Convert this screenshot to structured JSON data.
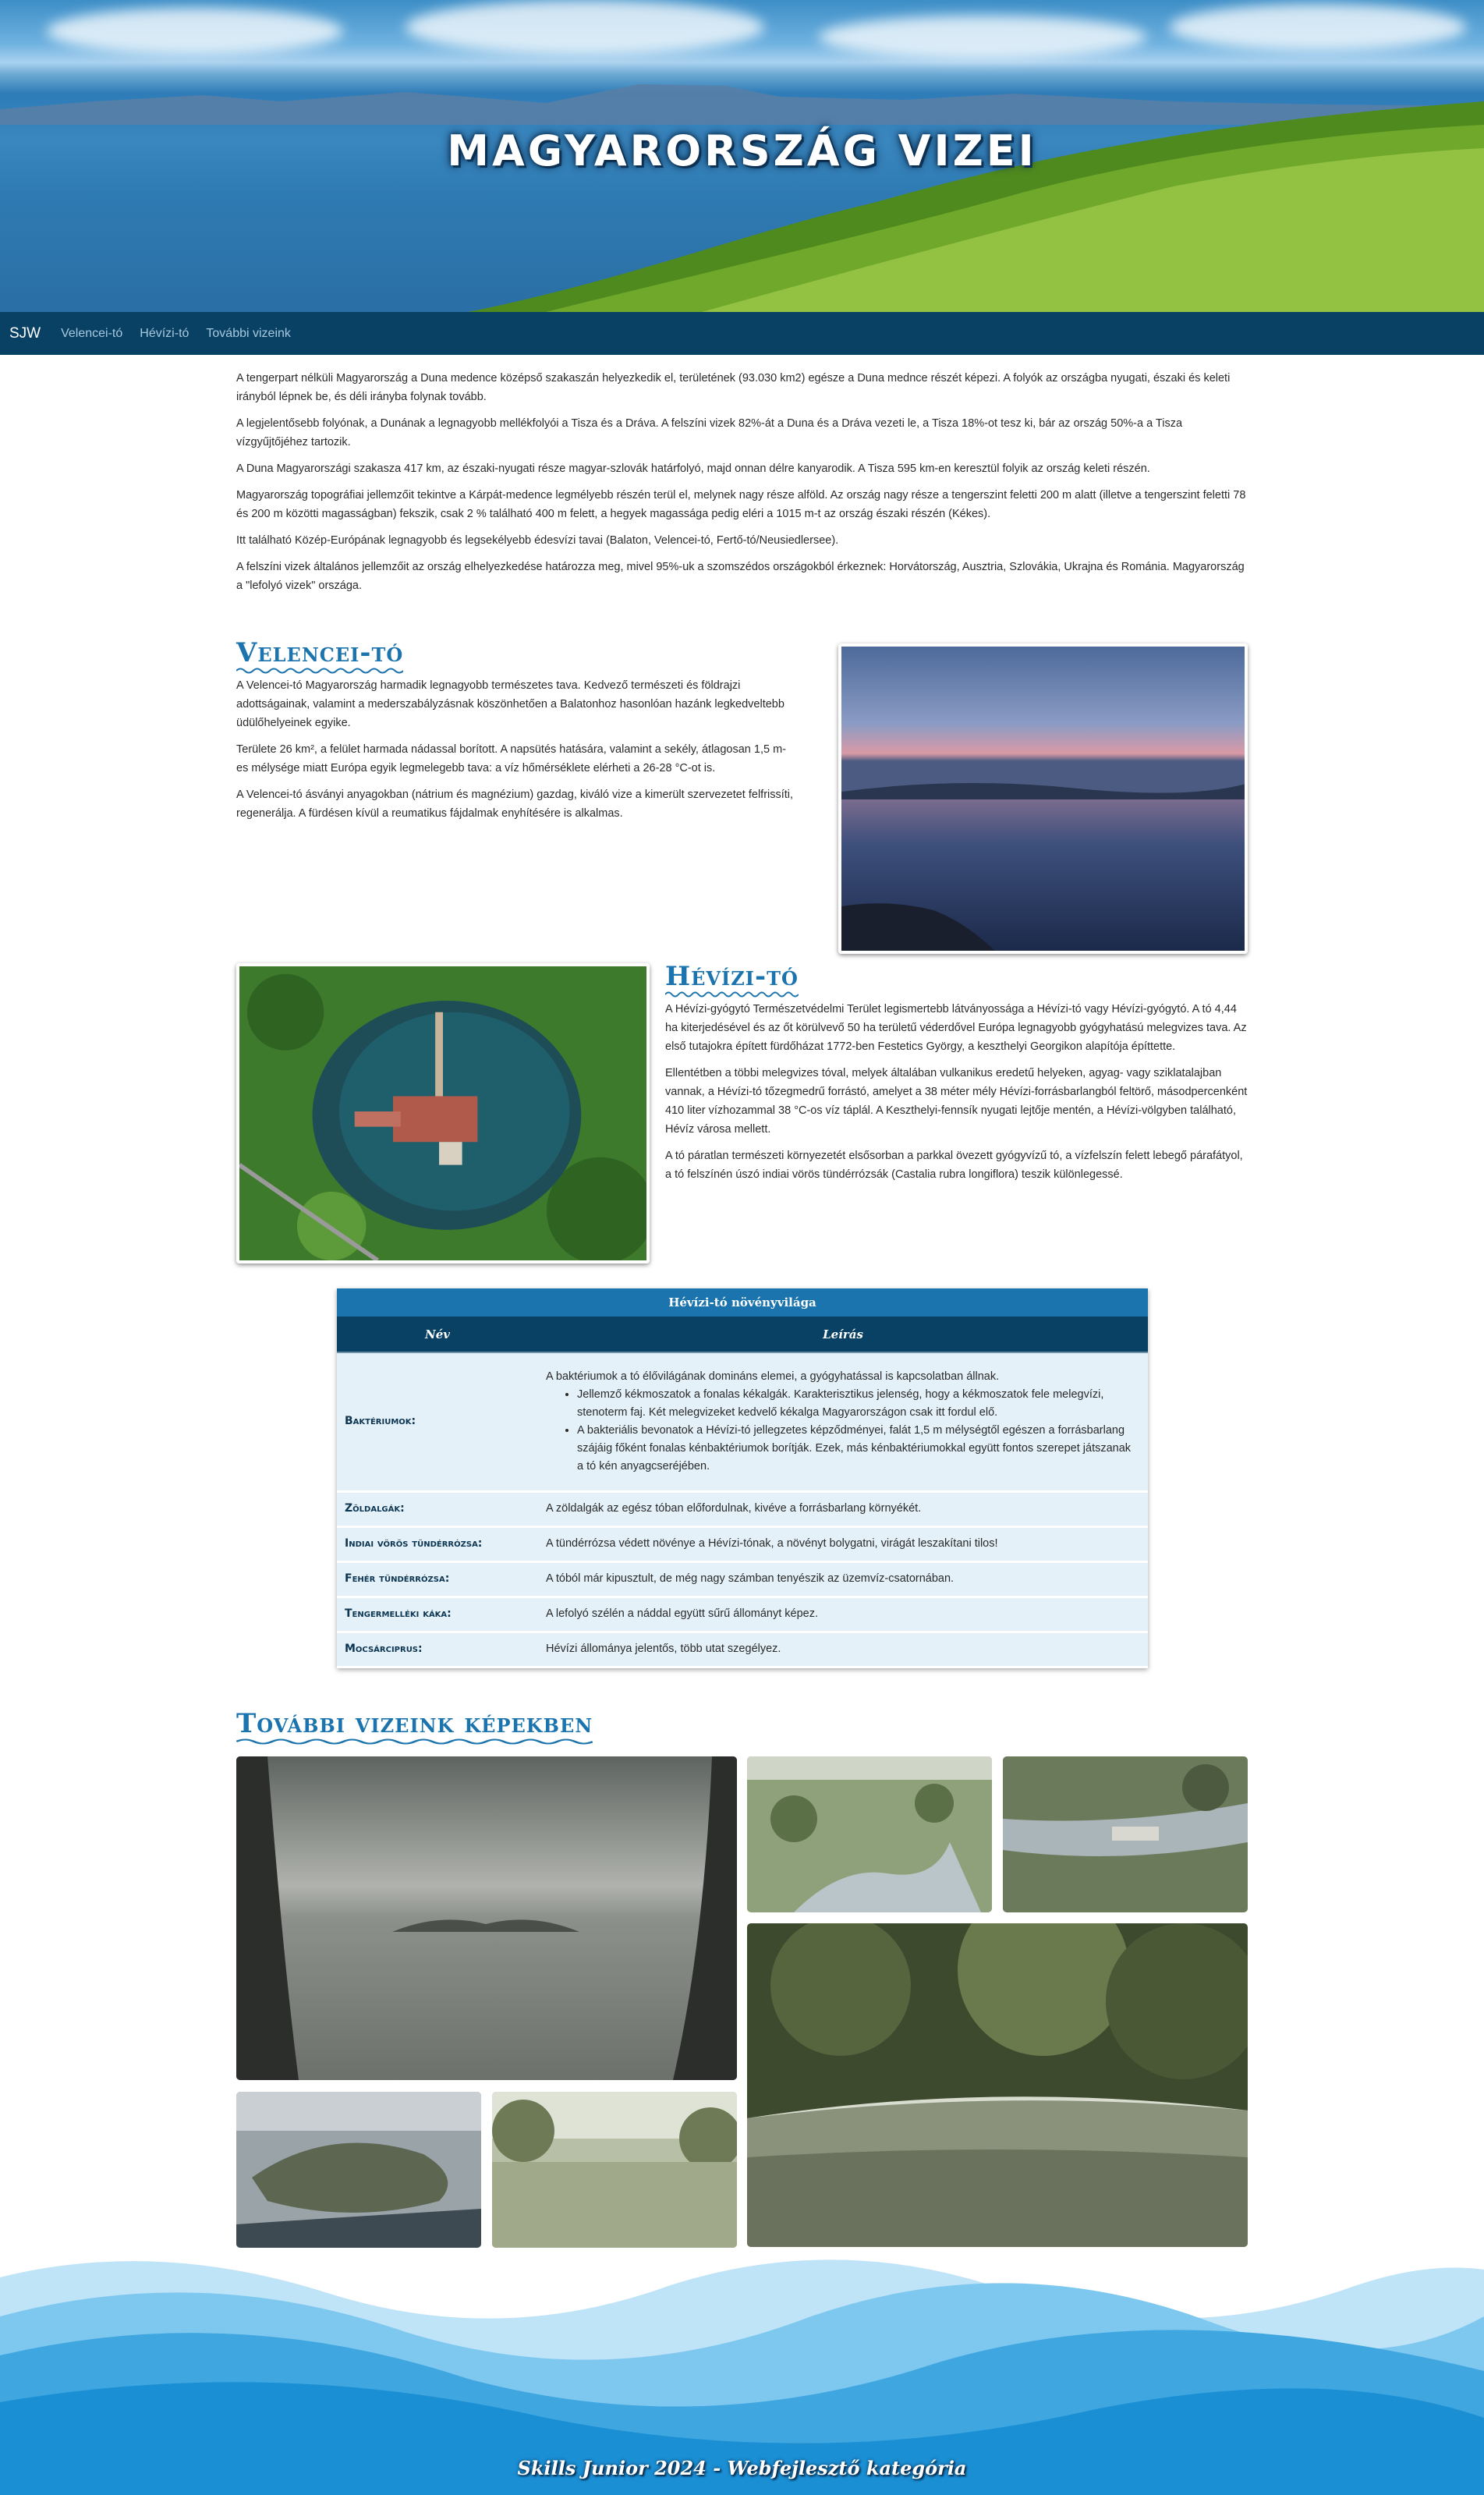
{
  "hero": {
    "title": "MAGYARORSZÁG VIZEI"
  },
  "nav": {
    "brand": "SJW",
    "links": [
      "Velencei-tó",
      "Hévízi-tó",
      "További vizeink"
    ]
  },
  "intro": [
    "A tengerpart nélküli Magyarország a Duna medence középső szakaszán helyezkedik el, területének (93.030 km2) egésze a Duna mednce részét képezi. A folyók az országba nyugati, északi és keleti irányból lépnek be, és déli irányba folynak tovább.",
    "A legjelentősebb folyónak, a Dunának a legnagyobb mellékfolyói a Tisza és a Dráva. A felszíni vizek 82%-át a Duna és a Dráva vezeti le, a Tisza 18%-ot tesz ki, bár az ország 50%-a a Tisza vízgyűjtőjéhez tartozik.",
    "A Duna Magyarországi szakasza 417 km, az északi-nyugati része magyar-szlovák határfolyó, majd onnan délre kanyarodik. A Tisza 595 km-en keresztül folyik az ország keleti részén.",
    "Magyarország topográfiai jellemzőit tekintve a Kárpát-medence legmélyebb részén terül el, melynek nagy része alföld. Az ország nagy része a tengerszint feletti 200 m alatt (illetve a tengerszint feletti 78 és 200 m közötti magasságban) fekszik, csak 2 % található 400 m felett, a hegyek magassága pedig eléri a 1015 m-t az ország északi részén (Kékes).",
    "Itt található Közép-Európának legnagyobb és legsekélyebb édesvízi tavai (Balaton, Velencei-tó, Fertő-tó/Neusiedlersee).",
    "A felszíni vizek általános jellemzőit az ország elhelyezkedése határozza meg, mivel 95%-uk a szomszédos országokból érkeznek: Horvátország, Ausztria, Szlovákia, Ukrajna és Románia. Magyarország a \"lefolyó vizek\" országa."
  ],
  "velencei": {
    "title": "Velencei-tó",
    "paragraphs": [
      "A Velencei-tó Magyarország harmadik legnagyobb természetes tava. Kedvező természeti és földrajzi adottságainak, valamint a mederszabályzásnak köszönhetően a Balatonhoz hasonlóan hazánk legkedveltebb üdülőhelyeinek egyike.",
      "Területe 26 km², a felület harmada nádassal borított. A napsütés hatására, valamint a sekély, átlagosan 1,5 m-es mélysége miatt Európa egyik legmelegebb tava: a víz hőmérséklete elérheti a 26-28 °C-ot is.",
      "A Velencei-tó ásványi anyagokban (nátrium és magnézium) gazdag, kiváló vize a kimerült szervezetet felfrissíti, regenerálja. A fürdésen kívül a reumatikus fájdalmak enyhítésére is alkalmas."
    ]
  },
  "hevizi": {
    "title": "Hévízi-tó",
    "paragraphs": [
      "A Hévízi-gyógytó Természetvédelmi Terület legismertebb látványossága a Hévízi-tó vagy Hévízi-gyógytó. A tó 4,44 ha kiterjedésével és az őt körülvevő 50 ha területű véderdővel Európa legnagyobb gyógyhatású melegvizes tava. Az első tutajokra épített fürdőházat 1772-ben Festetics György, a keszthelyi Georgikon alapítója építtette.",
      "Ellentétben a többi melegvizes tóval, melyek általában vulkanikus eredetű helyeken, agyag- vagy sziklatalajban vannak, a Hévízi-tó tőzegmedrű forrástó, amelyet a 38 méter mély Hévízi-forrásbarlangból feltörő, másodpercenként 410 liter vízhozammal 38 °C-os víz táplál. A Keszthelyi-fennsík nyugati lejtője mentén, a Hévízi-völgyben található, Hévíz városa mellett.",
      "A tó páratlan természeti környezetét elsősorban a parkkal övezett gyógyvízű tó, a vízfelszín felett lebegő párafátyol, a tó felszínén úszó indiai vörös tündérrózsák (Castalia rubra longiflora) teszik különlegessé."
    ]
  },
  "table": {
    "caption": "Hévízi-tó növényvilága",
    "headers": [
      "Név",
      "Leírás"
    ],
    "rows": [
      {
        "name": "Baktériumok:",
        "desc": "A baktériumok a tó élővilágának domináns elemei, a gyógyhatással is kapcsolatban állnak.",
        "bullets": [
          "Jellemző kékmoszatok a fonalas kékalgák. Karakterisztikus jelenség, hogy a kékmoszatok fele melegvízi, stenoterm faj. Két melegvizeket kedvelő kékalga Magyarországon csak itt fordul elő.",
          "A bakteriális bevonatok a Hévízi-tó jellegzetes képződményei, falát 1,5 m mélységtől egészen a forrásbarlang szájáig főként fonalas kénbaktériumok borítják. Ezek, más kénbaktériumokkal együtt fontos szerepet játszanak a tó kén anyagcseréjében."
        ]
      },
      {
        "name": "Zöldalgák:",
        "desc": "A zöldalgák az egész tóban előfordulnak, kivéve a forrásbarlang környékét."
      },
      {
        "name": "Indiai vörös tündérrózsa:",
        "desc": "A tündérrózsa védett növénye a Hévízi-tónak, a növényt bolygatni, virágát leszakítani tilos!"
      },
      {
        "name": "Fehér tündérrózsa:",
        "desc": "A tóból már kipusztult, de még nagy számban tenyészik az üzemvíz-csatornában."
      },
      {
        "name": "Tengermelléki káka:",
        "desc": "A lefolyó szélén a náddal együtt sűrű állományt képez."
      },
      {
        "name": "Mocsárciprus:",
        "desc": "Hévízi állománya jelentős, több utat szegélyez."
      }
    ]
  },
  "gallery": {
    "title": "További vizeink képekben"
  },
  "footer": {
    "text": "Skills Junior 2024 - Webfejlesztő kategória"
  }
}
